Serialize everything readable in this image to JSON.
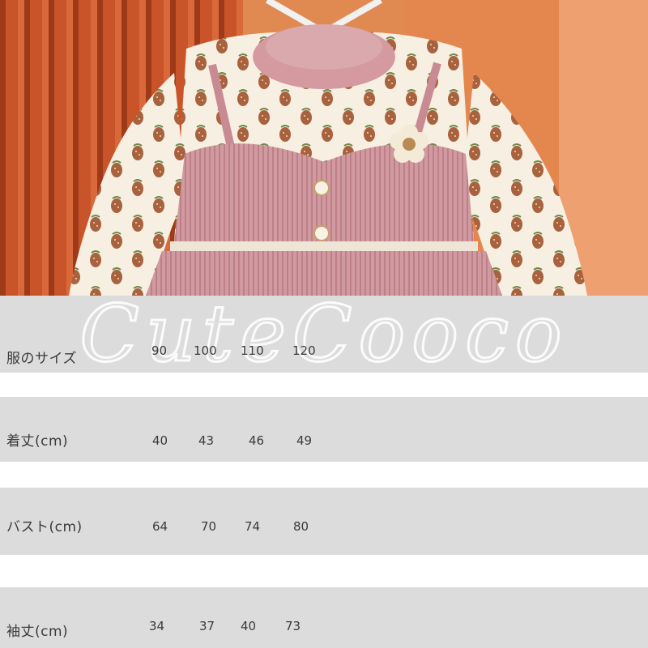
{
  "watermark_text": "CuteCooco",
  "rows": [
    {
      "key": "size",
      "label": "服のサイズ",
      "values": [
        "90",
        "100",
        "110",
        "120"
      ]
    },
    {
      "key": "length",
      "label": "着丈(cm)",
      "values": [
        "40",
        "43",
        "46",
        "49"
      ]
    },
    {
      "key": "bust",
      "label": "バスト(cm)",
      "values": [
        "64",
        "70",
        "74",
        "80"
      ]
    },
    {
      "key": "sleeve",
      "label": "袖丈(cm)",
      "values": [
        "34",
        "37",
        "40",
        "73"
      ]
    }
  ],
  "colors": {
    "band": "#dcdcdc",
    "text": "#3a3a3a",
    "background_orange": "#e08a52",
    "dress_pink": "#d49aa0",
    "print_cream": "#f6efe2",
    "strawberry_brown": "#a8623e"
  }
}
